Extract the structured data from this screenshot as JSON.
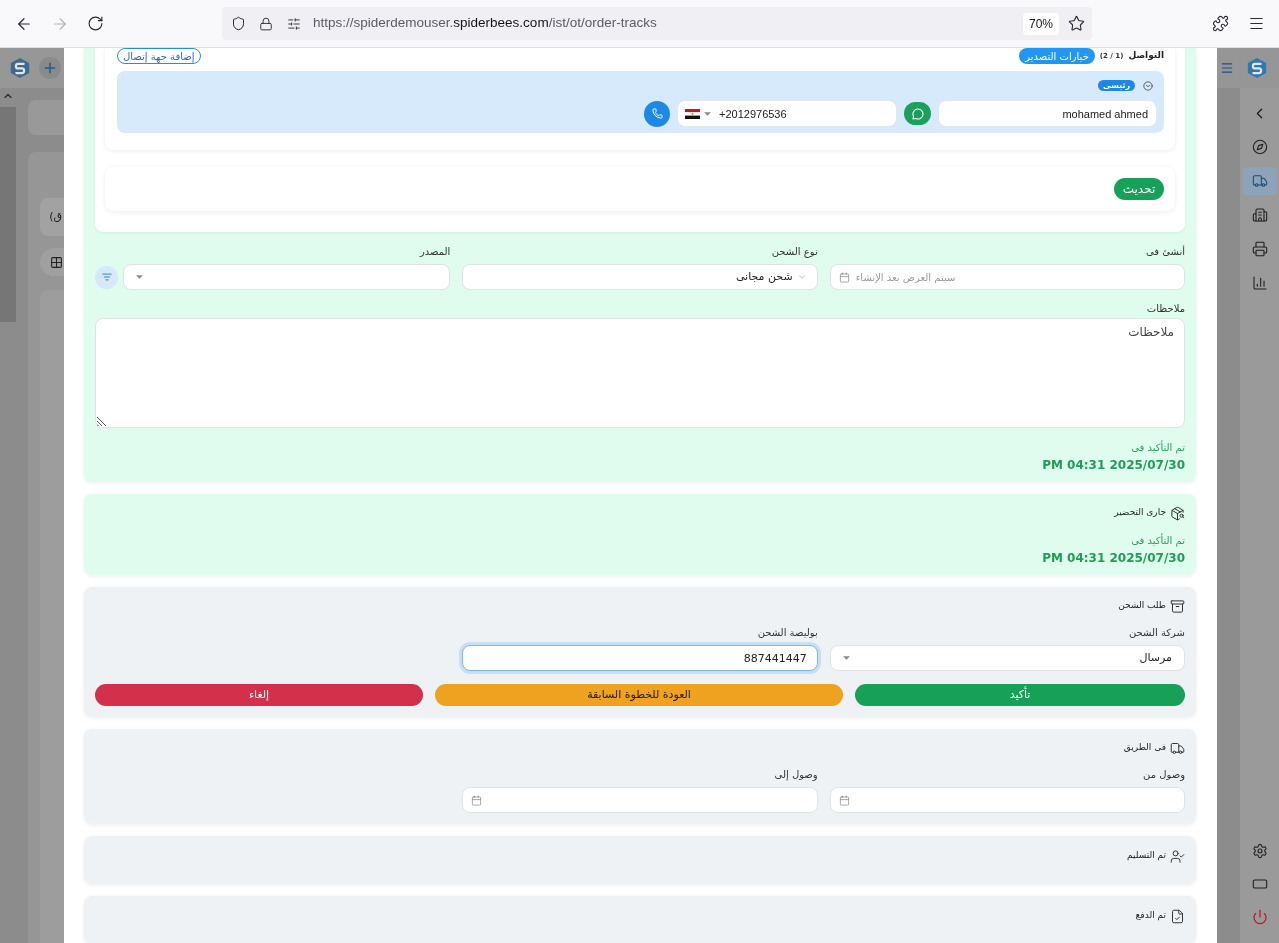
{
  "browser": {
    "url_start": "https://spiderdemouser.",
    "url_domain": "spiderbees.com",
    "url_end": "/ist/ot/order-tracks",
    "zoom": "70%"
  },
  "background_app": {
    "text": "ق)"
  },
  "sidebar": {
    "items": [
      {
        "selected": false
      },
      {
        "selected": true
      },
      {
        "selected": false
      },
      {
        "selected": false
      },
      {
        "selected": false
      }
    ]
  },
  "order_details": {
    "completed": true,
    "contacts": {
      "title": "التواصل",
      "count": "(2 / 1)",
      "export_button": "خيارات التصدير",
      "add_button": "إضافة جهة إتصال",
      "items": [
        {
          "badge": "رئيسى",
          "name": "mohamed ahmed",
          "phone": "+2012976536"
        }
      ]
    },
    "update_button": "تحديث",
    "fields": [
      {
        "label": "أنشئ فى",
        "kind": "date",
        "placeholder": "سيتم العرض بعد الإنشاء",
        "focused": false
      },
      {
        "label": "نوع الشحن",
        "kind": "select",
        "value": "شحن مجانى",
        "focused": false
      },
      {
        "label": "المصدر",
        "kind": "dropdown",
        "focused": false,
        "addon_button": true
      }
    ],
    "notes": {
      "label": "ملاحظات",
      "value": "ملاحظات"
    },
    "confirmed_label": "تم التأكيد فى",
    "confirmed_time": "PM 04:31 2025/07/30"
  },
  "stages": [
    {
      "title": "جارى التحضير",
      "completed": true,
      "confirmed_label": "تم التأكيد فى",
      "confirmed_time": "PM 04:31 2025/07/30"
    },
    {
      "title": "طلب الشحن",
      "completed": false,
      "fields": [
        {
          "label": "شركة الشحن",
          "kind": "dropdown",
          "value": "مرسال",
          "focused": false
        },
        {
          "label": "بوليصة الشحن",
          "kind": "text",
          "value": "887441447",
          "focused": true
        }
      ],
      "buttons": [
        {
          "label": "تأكيد",
          "kind": "confirm"
        },
        {
          "label": "العودة للخطوة السابقة",
          "kind": "back"
        },
        {
          "label": "إلغاء",
          "kind": "cancel"
        }
      ]
    },
    {
      "title": "فى الطريق",
      "completed": false,
      "fields": [
        {
          "label": "وصول من",
          "kind": "date",
          "focused": false
        },
        {
          "label": "وصول إلى",
          "kind": "date",
          "focused": false
        }
      ]
    },
    {
      "title": "تم التسليم",
      "completed": false
    },
    {
      "title": "تم الدفع",
      "completed": false
    }
  ]
}
